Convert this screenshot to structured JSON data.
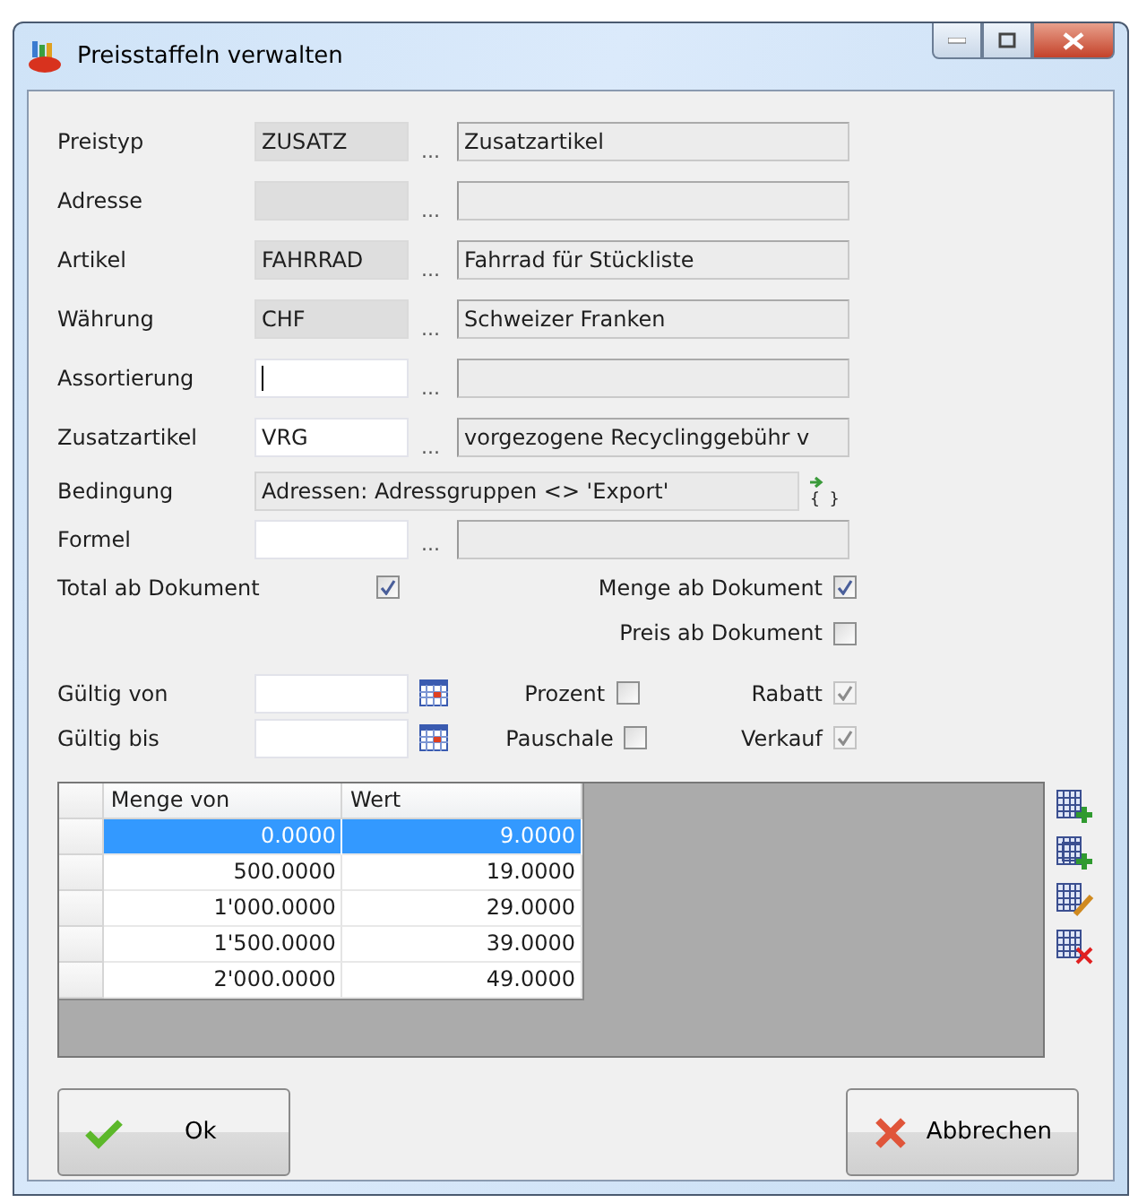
{
  "window": {
    "title": "Preisstaffeln verwalten"
  },
  "fields": [
    {
      "kind": "lookup",
      "label": "Preistyp",
      "code": "ZUSATZ",
      "editable": false,
      "dots": "...",
      "description": "Zusatzartikel"
    },
    {
      "kind": "lookup",
      "label": "Adresse",
      "editable": false,
      "dots": "..."
    },
    {
      "kind": "lookup",
      "label": "Artikel",
      "code": "FAHRRAD",
      "editable": false,
      "dots": "...",
      "description": "Fahrrad für Stückliste"
    },
    {
      "kind": "lookup",
      "label": "Währung",
      "code": "CHF",
      "editable": false,
      "dots": "...",
      "description": "Schweizer Franken"
    },
    {
      "kind": "lookup",
      "label": "Assortierung",
      "editable": true,
      "focused": true,
      "dots": "..."
    },
    {
      "kind": "lookup",
      "label": "Zusatzartikel",
      "code": "VRG",
      "editable": true,
      "dots": "...",
      "description": "vorgezogene Recyclinggebühr v"
    },
    {
      "kind": "condition",
      "label": "Bedingung",
      "value": "Adressen: Adressgruppen <> 'Export'",
      "editor_glyph": "{ }"
    },
    {
      "kind": "lookup",
      "label": "Formel",
      "editable": true,
      "dots": "..."
    }
  ],
  "options": {
    "total": {
      "label": "Total ab Dokument",
      "checked": true,
      "disabled": false
    },
    "menge": {
      "label": "Menge ab Dokument",
      "checked": true,
      "disabled": false
    },
    "preis": {
      "label": "Preis ab Dokument",
      "checked": false,
      "disabled": false
    }
  },
  "validity": [
    {
      "label": "Gültig von",
      "flag": {
        "label": "Prozent",
        "checked": false,
        "disabled": false
      },
      "flag2": {
        "label": "Rabatt",
        "checked": true,
        "disabled": true
      }
    },
    {
      "label": "Gültig bis",
      "flag": {
        "label": "Pauschale",
        "checked": false,
        "disabled": false
      },
      "flag2": {
        "label": "Verkauf",
        "checked": true,
        "disabled": true
      }
    }
  ],
  "table": {
    "columns": [
      "Menge von",
      "Wert"
    ],
    "rows": [
      {
        "cells": [
          "0.0000",
          "9.0000"
        ],
        "selected": true
      },
      {
        "cells": [
          "500.0000",
          "19.0000"
        ],
        "selected": false
      },
      {
        "cells": [
          "1'000.0000",
          "29.0000"
        ],
        "selected": false
      },
      {
        "cells": [
          "1'500.0000",
          "39.0000"
        ],
        "selected": false
      },
      {
        "cells": [
          "2'000.0000",
          "49.0000"
        ],
        "selected": false
      }
    ]
  },
  "buttons": {
    "ok": "Ok",
    "cancel": "Abbrechen"
  }
}
